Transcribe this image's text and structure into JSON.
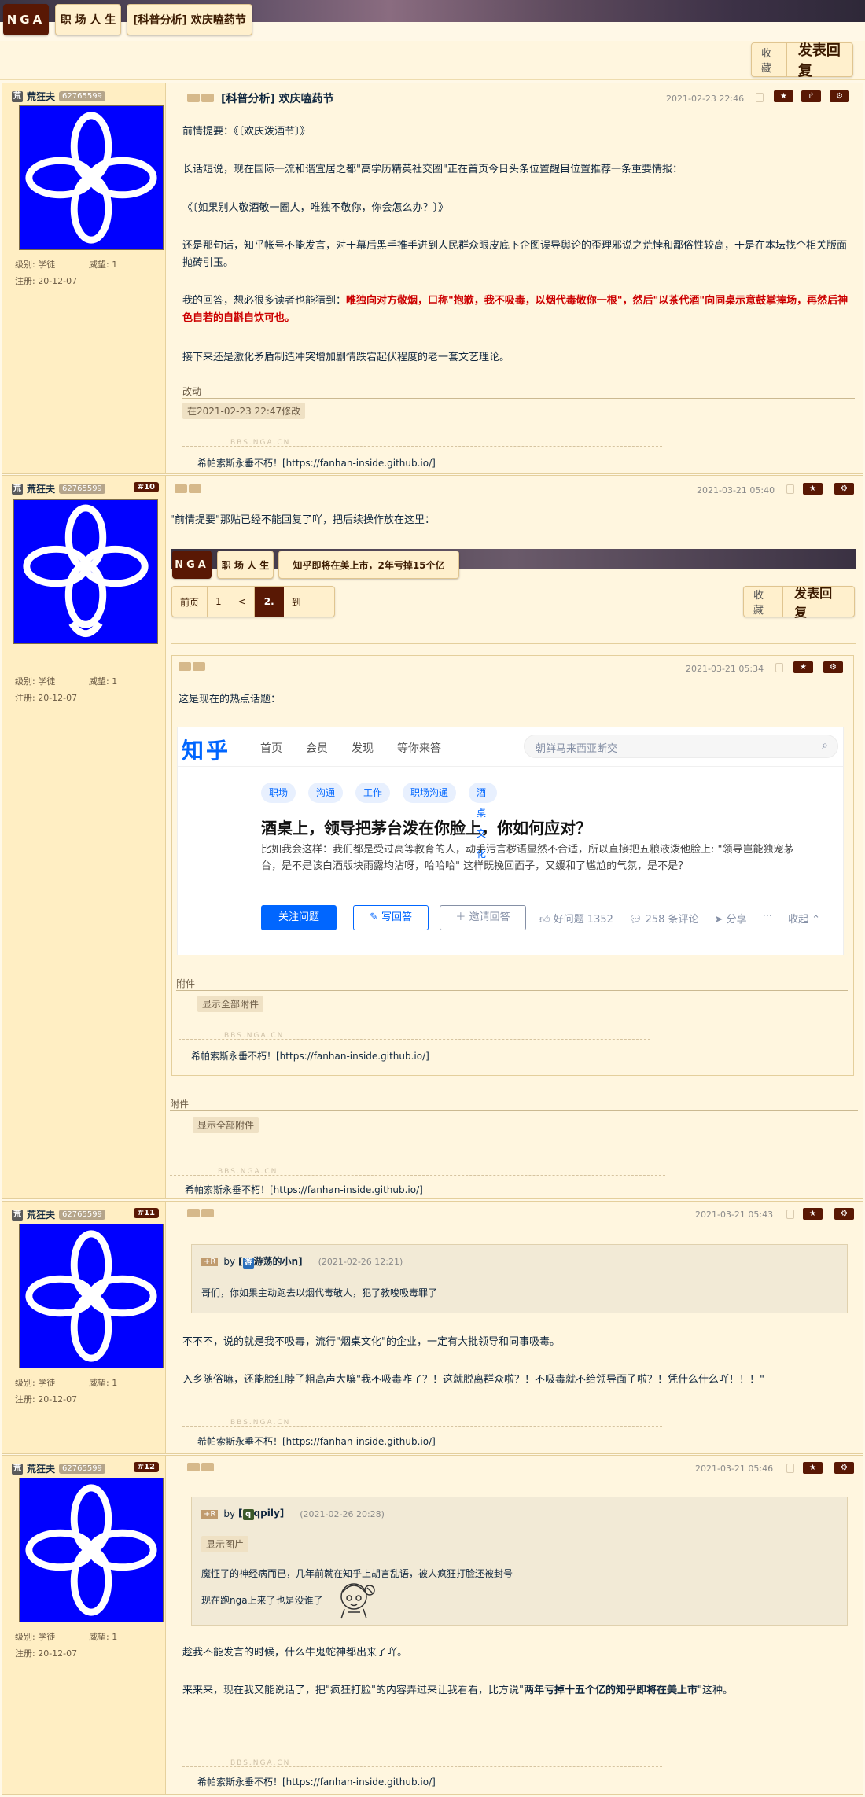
{
  "header": {
    "logo": "NGA",
    "tab1": "职 场 人 生",
    "tab2": "[科普分析] 欢庆嗑药节",
    "fav": "收藏",
    "reply": "发表回复"
  },
  "post1": {
    "user": "荒狂夫",
    "user_icon": "荒",
    "uid": "62765599",
    "level": "级别: 学徒",
    "prestige": "威望: 1",
    "reg": "注册: 20-12-07",
    "title": "[科普分析] 欢庆嗑药节",
    "date": "2021-02-23 22:46",
    "p1": "前情提要：《〔欢庆泼酒节〕》",
    "p2": "长话短说，现在国际一流和谐宜居之都\"高学历精英社交圈\"正在首页今日头条位置醒目位置推荐一条重要情报：",
    "p3": "《〔如果别人敬酒敬一圈人，唯独不敬你，你会怎么办？〕》",
    "p4": "还是那句话，知乎帐号不能发言，对于幕后黑手推手进到人民群众眼皮底下企图误导舆论的歪理邪说之荒悖和鄙俗性较高，于是在本坛找个相关版面抛砖引玉。",
    "p5a": "我的回答，想必很多读者也能猜到：",
    "p5b": "唯独向对方敬烟，口称\"抱歉，我不吸毒，以烟代毒敬你一根\"，然后\"以茶代酒\"向同桌示意鼓掌捧场，再然后神色自若的自斟自饮可也。",
    "p6": "接下来还是激化矛盾制造冲突增加剧情跌宕起伏程度的老一套文艺理论。",
    "edit_label": "改动",
    "edit_tag": "在2021-02-23 22:47修改",
    "sig_wm": "BBS.NGA.CN",
    "sig": "希帕索斯永垂不朽！[https://fanhan-inside.github.io/]"
  },
  "post2": {
    "user": "荒狂夫",
    "user_icon": "荒",
    "uid": "62765599",
    "floor": "#10",
    "level": "级别: 学徒",
    "prestige": "威望: 1",
    "reg": "注册: 20-12-07",
    "date": "2021-03-21 05:40",
    "p1": "\"前情提要\"那贴已经不能回复了吖，把后续操作放在这里：",
    "nested": {
      "logo": "NGA",
      "tab1": "职 场 人 生",
      "tab2": "知乎即将在美上市，2年亏掉15个亿",
      "pages": [
        "前页",
        "1",
        "<",
        "2.",
        "到"
      ],
      "fav": "收藏",
      "reply": "发表回复",
      "date": "2021-03-21 05:34",
      "p1": "这是现在的热点话题：",
      "zhihu": {
        "logo": "知乎",
        "nav": [
          "首页",
          "会员",
          "发现",
          "等你来答"
        ],
        "search": "朝鲜马来西亚断交",
        "topics": [
          "职场",
          "沟通",
          "工作",
          "职场沟通",
          "酒桌文化"
        ],
        "title": "酒桌上，领导把茅台泼在你脸上，你如何应对？",
        "body": "比如我会这样：我们都是受过高等教育的人，动手污言秽语显然不合适，所以直接把五粮液泼他脸上: \"领导岂能独宠茅台，是不是该白酒版块雨露均沾呀，哈哈哈\" 这样既挽回面子，又缓和了尴尬的气氛，是不是？",
        "follow": "关注问题",
        "write": "写回答",
        "invite": "邀请回答",
        "good": "好问题 1352",
        "comments": "258 条评论",
        "share": "分享",
        "more": "···",
        "collapse": "收起"
      },
      "attach": "附件",
      "show_attach": "显示全部附件",
      "sig_wm": "BBS.NGA.CN",
      "sig": "希帕索斯永垂不朽！[https://fanhan-inside.github.io/]"
    },
    "attach": "附件",
    "show_attach": "显示全部附件",
    "sig_wm": "BBS.NGA.CN",
    "sig": "希帕索斯永垂不朽！[https://fanhan-inside.github.io/]"
  },
  "post3": {
    "user": "荒狂夫",
    "user_icon": "荒",
    "uid": "62765599",
    "floor": "#11",
    "level": "级别: 学徒",
    "prestige": "威望: 1",
    "reg": "注册: 20-12-07",
    "date": "2021-03-21 05:43",
    "q_by": "by",
    "q_user": "游荡的小n",
    "q_user_icon": "游",
    "q_date": "(2021-02-26 12:21)",
    "q_text": "哥们，你如果主动跑去以烟代毒敬人，犯了教唆吸毒罪了",
    "p1": "不不不，说的就是我不吸毒，流行\"烟桌文化\"的企业，一定有大批领导和同事吸毒。",
    "p2": "入乡随俗嘛，还能脸红脖子粗高声大嚷\"我不吸毒咋了？！这就脱离群众啦？！不吸毒就不给领导面子啦？！凭什么什么吖！！！\"",
    "sig_wm": "BBS.NGA.CN",
    "sig": "希帕索斯永垂不朽！[https://fanhan-inside.github.io/]"
  },
  "post4": {
    "user": "荒狂夫",
    "user_icon": "荒",
    "uid": "62765599",
    "floor": "#12",
    "level": "级别: 学徒",
    "prestige": "威望: 1",
    "reg": "注册: 20-12-07",
    "date": "2021-03-21 05:46",
    "q_by": "by",
    "q_user": "qpily",
    "q_user_icon": "q",
    "q_date": "(2021-02-26 20:28)",
    "q_show_img": "显示图片",
    "q_text1": "魔怔了的神经病而已，几年前就在知乎上胡言乱语，被人疯狂打脸还被封号",
    "q_text2": "现在跑nga上来了也是没谁了",
    "p1": "趁我不能发言的时候，什么牛鬼蛇神都出来了吖。",
    "p2a": "来来来，现在我又能说话了，把\"疯狂打脸\"的内容弄过来让我看看，比方说\"",
    "p2b": "两年亏掉十五个亿的知乎即将在美上市",
    "p2c": "\"这种。",
    "sig_wm": "BBS.NGA.CN",
    "sig": "希帕索斯永垂不朽！[https://fanhan-inside.github.io/]"
  }
}
